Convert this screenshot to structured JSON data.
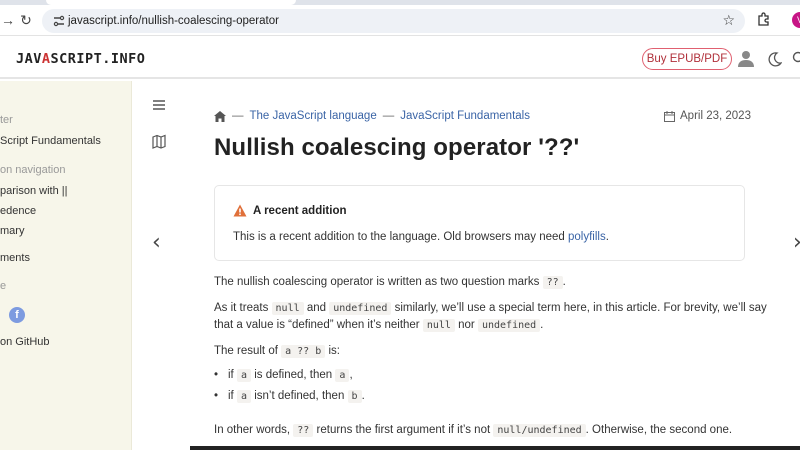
{
  "browser": {
    "url": "javascript.info/nullish-coalescing-operator",
    "profile_initial": "V"
  },
  "site": {
    "logo_part1": "JAV",
    "logo_part2": "A",
    "logo_part3": "SCRIPT.INFO",
    "buy_label": "Buy EPUB/PDF"
  },
  "sidebar": {
    "chapter_heading": "ter",
    "chapter_link": "Script Fundamentals",
    "section_nav_heading": "on navigation",
    "nav_items": [
      "parison with ||",
      "edence",
      "mary"
    ],
    "comments": "ments",
    "share_heading": "e",
    "facebook_glyph": "f",
    "github": "on GitHub"
  },
  "breadcrumb": {
    "items": [
      "The JavaScript language",
      "JavaScript Fundamentals"
    ],
    "separator": "—"
  },
  "date": "April 23, 2023",
  "title": "Nullish coalescing operator '??'",
  "notice": {
    "title": "A recent addition",
    "body": "This is a recent addition to the language. Old browsers may need",
    "link": "polyfills",
    "end": "."
  },
  "content": {
    "p1_a": "The nullish coalescing operator is written as two question marks",
    "p1_code": "??",
    "p1_b": ".",
    "p2_a": "As it treats",
    "p2_code1": "null",
    "p2_b": "and",
    "p2_code2": "undefined",
    "p2_c": "similarly, we’ll use a special term here, in this article. For brevity, we’ll say",
    "p2_d": "that a value is “defined” when it’s neither",
    "p2_code3": "null",
    "p2_e": "nor",
    "p2_code4": "undefined",
    "p2_f": ".",
    "p3_a": "The result of",
    "p3_code": "a ?? b",
    "p3_b": "is:",
    "b1_a": "if",
    "b1_code1": "a",
    "b1_b": "is defined, then",
    "b1_code2": "a",
    "b1_c": ",",
    "b2_a": "if",
    "b2_code1": "a",
    "b2_b": "isn’t defined, then",
    "b2_code2": "b",
    "b2_c": ".",
    "p4_a": "In other words,",
    "p4_code1": "??",
    "p4_b": "returns the first argument if it’s not",
    "p4_code2": "null/undefined",
    "p4_c": ". Otherwise, the second one."
  },
  "colors": {
    "accent_link": "#3a64a6",
    "sidebar_bg": "#f7f6ea",
    "warning": "#e0703a"
  }
}
